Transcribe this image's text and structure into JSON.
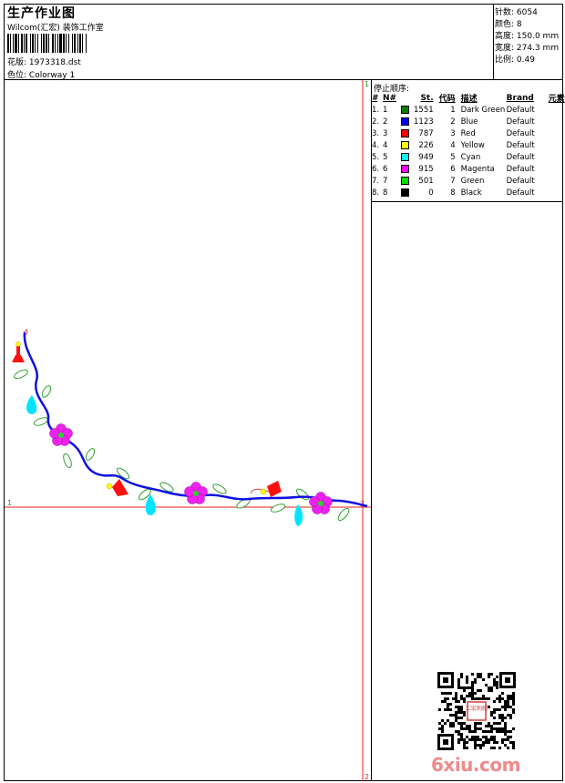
{
  "header": {
    "title": "生产作业图",
    "company": "Wilcom(汇宏) 装饰工作室",
    "design_label": "花版:",
    "design_file": "1973318.dst",
    "colorway_label": "色位:",
    "colorway": "Colorway 1"
  },
  "stats": [
    {
      "label": "针数:",
      "value": "6054"
    },
    {
      "label": "颜色:",
      "value": "8"
    },
    {
      "label": "高度:",
      "value": "150.0 mm"
    },
    {
      "label": "宽度:",
      "value": "274.3 mm"
    },
    {
      "label": "比例:",
      "value": "0.49"
    }
  ],
  "canvas": {
    "marker_left": "1",
    "marker_right": "2",
    "marker_top": "1",
    "marker_bottom": "2"
  },
  "stop_sequence": {
    "title": "停止顺序:",
    "columns": [
      "#",
      "N#",
      "St.",
      "代码",
      "描述",
      "Brand",
      "元素"
    ],
    "rows": [
      {
        "idx": "1.",
        "n": "1",
        "color": "#008000",
        "st": "1551",
        "code": "1",
        "desc": "Dark Green",
        "brand": "Default"
      },
      {
        "idx": "2.",
        "n": "2",
        "color": "#0000ff",
        "st": "1123",
        "code": "2",
        "desc": "Blue",
        "brand": "Default"
      },
      {
        "idx": "3.",
        "n": "3",
        "color": "#ff0000",
        "st": "787",
        "code": "3",
        "desc": "Red",
        "brand": "Default"
      },
      {
        "idx": "4.",
        "n": "4",
        "color": "#ffff00",
        "st": "226",
        "code": "4",
        "desc": "Yellow",
        "brand": "Default"
      },
      {
        "idx": "5.",
        "n": "5",
        "color": "#00ffff",
        "st": "949",
        "code": "5",
        "desc": "Cyan",
        "brand": "Default"
      },
      {
        "idx": "6.",
        "n": "6",
        "color": "#ff00ff",
        "st": "915",
        "code": "6",
        "desc": "Magenta",
        "brand": "Default"
      },
      {
        "idx": "7.",
        "n": "7",
        "color": "#00dd00",
        "st": "501",
        "code": "7",
        "desc": "Green",
        "brand": "Default"
      },
      {
        "idx": "8.",
        "n": "8",
        "color": "#000000",
        "st": "0",
        "code": "8",
        "desc": "Black",
        "brand": "Default"
      }
    ]
  },
  "watermark": {
    "logo_text": "6xiu.com",
    "seal_text": "汇宏刺绣"
  }
}
